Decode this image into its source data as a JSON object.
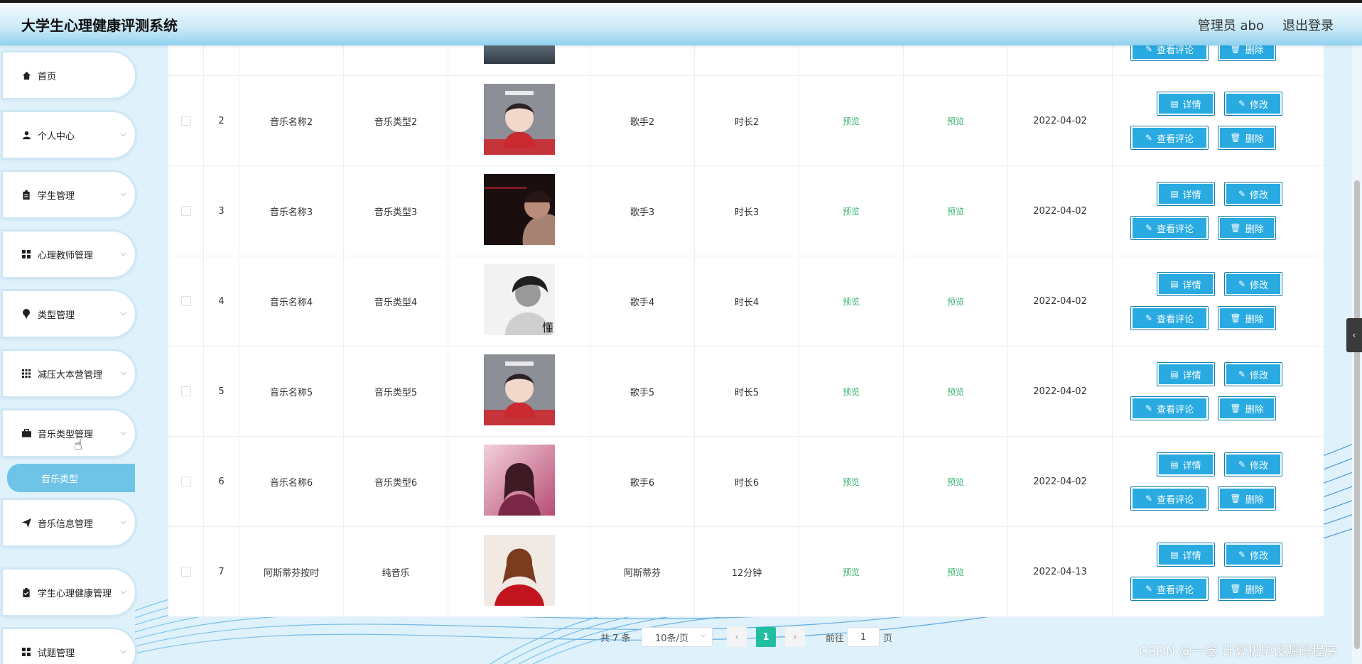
{
  "header": {
    "title": "大学生心理健康评测系统",
    "user": "管理员 abo",
    "logout": "退出登录"
  },
  "sidebar": {
    "items": [
      {
        "label": "首页",
        "icon": "home-icon"
      },
      {
        "label": "个人中心",
        "icon": "user-icon"
      },
      {
        "label": "学生管理",
        "icon": "clipboard-icon"
      },
      {
        "label": "心理教师管理",
        "icon": "grid-icon"
      },
      {
        "label": "类型管理",
        "icon": "pin-icon"
      },
      {
        "label": "减压大本营管理",
        "icon": "apps-icon"
      },
      {
        "label": "音乐类型管理",
        "icon": "briefcase-icon"
      },
      {
        "label": "音乐信息管理",
        "icon": "send-icon"
      },
      {
        "label": "学生心理健康管理",
        "icon": "checklist-icon"
      },
      {
        "label": "试题管理",
        "icon": "grid-icon"
      }
    ],
    "active_sub": "音乐类型"
  },
  "table": {
    "rows": [
      {
        "index": "2",
        "name": "音乐名称2",
        "type": "音乐类型2",
        "singer": "歌手2",
        "duration": "时长2",
        "preview1": "预览",
        "preview2": "预览",
        "date": "2022-04-02",
        "cover": "cover-girl-red"
      },
      {
        "index": "3",
        "name": "音乐名称3",
        "type": "音乐类型3",
        "singer": "歌手3",
        "duration": "时长3",
        "preview1": "预览",
        "preview2": "预览",
        "date": "2022-04-02",
        "cover": "cover-dark-man"
      },
      {
        "index": "4",
        "name": "音乐名称4",
        "type": "音乐类型4",
        "singer": "歌手4",
        "duration": "时长4",
        "preview1": "预览",
        "preview2": "预览",
        "date": "2022-04-02",
        "cover": "cover-bw-man"
      },
      {
        "index": "5",
        "name": "音乐名称5",
        "type": "音乐类型5",
        "singer": "歌手5",
        "duration": "时长5",
        "preview1": "预览",
        "preview2": "预览",
        "date": "2022-04-02",
        "cover": "cover-girl-red"
      },
      {
        "index": "6",
        "name": "音乐名称6",
        "type": "音乐类型6",
        "singer": "歌手6",
        "duration": "时长6",
        "preview1": "预览",
        "preview2": "预览",
        "date": "2022-04-02",
        "cover": "cover-pink-woman"
      },
      {
        "index": "7",
        "name": "阿斯蒂芬按时",
        "type": "纯音乐",
        "singer": "阿斯蒂芬",
        "duration": "12分钟",
        "preview1": "预览",
        "preview2": "预览",
        "date": "2022-04-13",
        "cover": "cover-red-woman"
      }
    ],
    "actions": {
      "detail": "详情",
      "edit": "修改",
      "comments": "查看评论",
      "delete": "删除"
    }
  },
  "pagination": {
    "total": "共 7 条",
    "page_size": "10条/页",
    "current_page": "1",
    "goto_label": "前往",
    "goto_value": "1",
    "goto_unit": "页"
  },
  "watermark": "CSDN @一念 计算机毕设源码程序",
  "colors": {
    "accent": "#29abe2",
    "preview_text": "#3cb371",
    "active_page": "#1fbfa0",
    "active_sub": "#6ec3e7"
  }
}
